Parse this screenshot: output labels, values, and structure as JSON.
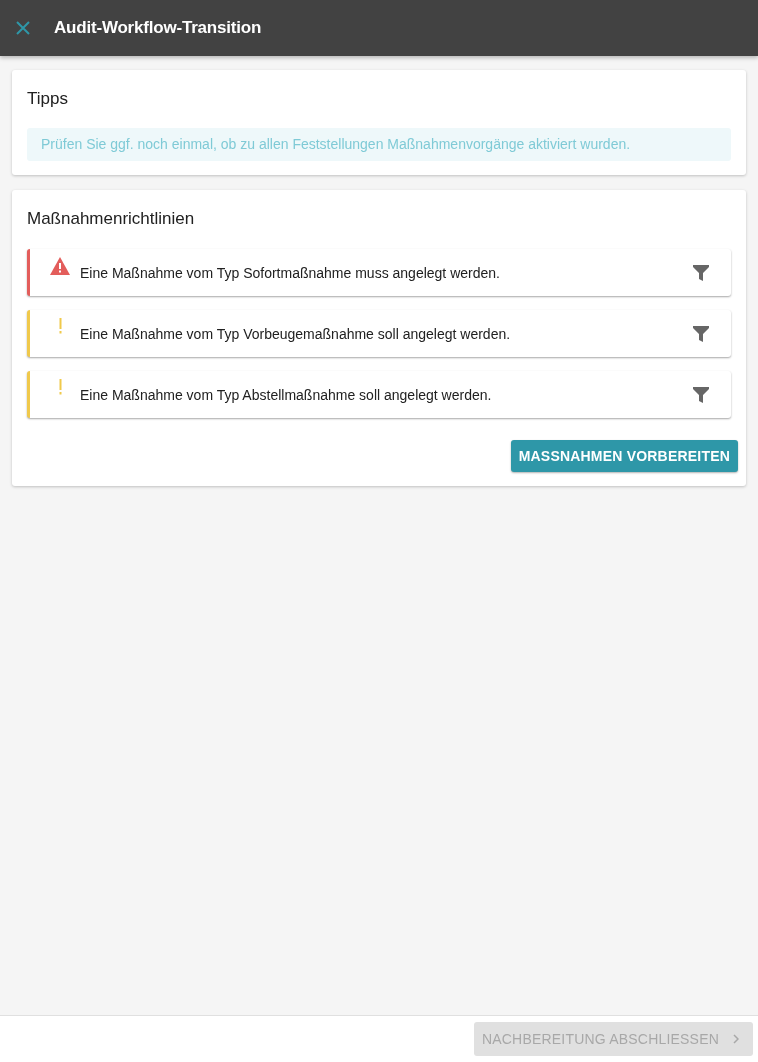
{
  "header": {
    "title": "Audit-Workflow-Transition"
  },
  "tips": {
    "title": "Tipps",
    "message": "Prüfen Sie ggf. noch einmal, ob zu allen Feststellungen Maßnahmenvorgänge aktiviert wurden."
  },
  "guidelines": {
    "title": "Maßnahmenrichtlinien",
    "items": [
      {
        "kind": "error",
        "text": "Eine Maßnahme vom Typ Sofortmaßnahme muss angelegt werden."
      },
      {
        "kind": "warning",
        "text": "Eine Maßnahme vom Typ Vorbeugemaßnahme soll angelegt werden."
      },
      {
        "kind": "warning",
        "text": "Eine Maßnahme vom Typ Abstellmaßnahme soll angelegt werden."
      }
    ],
    "button": "MASSNAHMEN VORBEREITEN"
  },
  "footer": {
    "button": {
      "label": "NACHBEREITUNG ABSCHLIESSEN",
      "disabled": true
    }
  }
}
